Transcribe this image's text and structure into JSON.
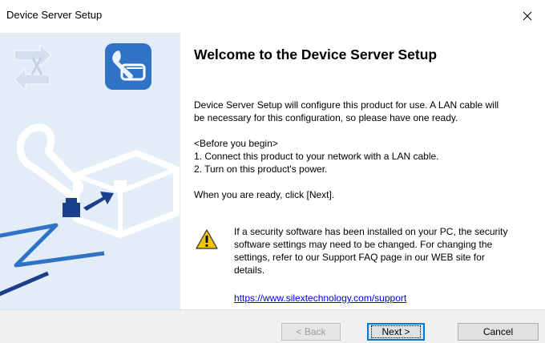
{
  "window": {
    "title": "Device Server Setup",
    "close_glyph": "✕"
  },
  "content": {
    "heading": "Welcome to the Device Server Setup",
    "intro_line1": "Device Server Setup will configure this product for use. A LAN cable will",
    "intro_line2": "be necessary for this configuration, so please have one ready.",
    "before_title": "<Before you begin>",
    "step1": "1. Connect this product to your network with a LAN cable.",
    "step2": "2. Turn on this product's power.",
    "ready_text": "When you are ready, click [Next].",
    "warning_line1": "If a security software has been installed on your PC, the security",
    "warning_line2": "software settings may need to be changed. For changing the",
    "warning_line3": "settings, refer to our Support FAQ page in our WEB site for",
    "warning_line4": "details.",
    "support_url": "https://www.silextechnology.com/support"
  },
  "buttons": {
    "back": "< Back",
    "next": "Next >",
    "cancel": "Cancel"
  },
  "colors": {
    "side_panel": "#e3edf8",
    "accent_blue": "#2f73c6",
    "link": "#0000ee"
  },
  "icons": {
    "close": "close-icon",
    "warning": "warning-icon",
    "wrench_device": "wrench-device-icon",
    "network": "network-arrows-icon"
  }
}
